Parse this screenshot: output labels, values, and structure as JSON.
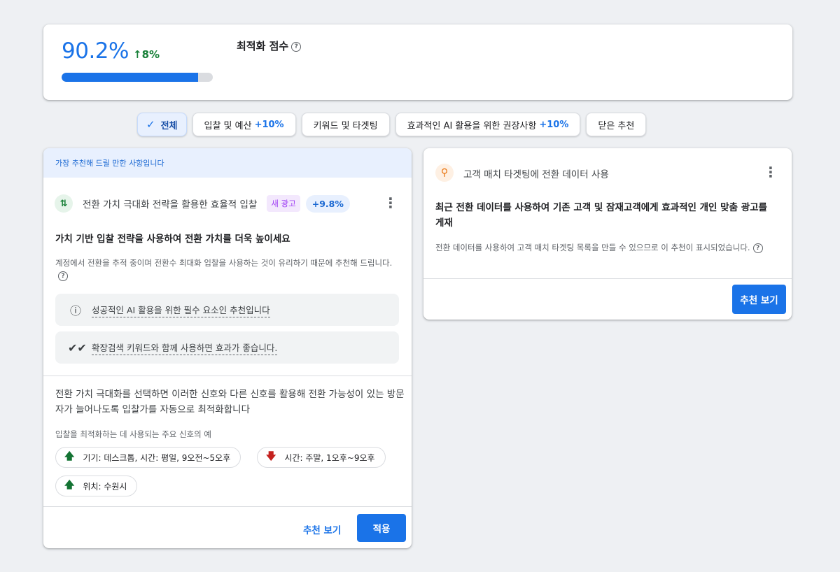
{
  "score": {
    "value": "90.2%",
    "change": "↑8%",
    "progress": 0.902,
    "title": "최적화 점수",
    "help_icon": "help-circle-icon"
  },
  "filters": [
    {
      "label": "전체",
      "pct": "",
      "active": true
    },
    {
      "label": "입찰 및 예산",
      "pct": "+10%",
      "active": false
    },
    {
      "label": "키워드 및 타겟팅",
      "pct": "",
      "active": false
    },
    {
      "label": "효과적인 AI 활용을 위한 권장사항",
      "pct": "+10%",
      "active": false
    },
    {
      "label": "닫은 추천",
      "pct": "",
      "active": false
    }
  ],
  "left_card": {
    "header": "가장 추천해 드릴 만한 사항입니다",
    "icon": "bidding-arrows-icon",
    "title": "전환 가치 극대화 전략을 활용한 효율적 입찰",
    "badge_new": "새 광고",
    "badge_pct": "+9.8%",
    "headline": "가치 기반 입찰 전략을 사용하여 전환 가치를 더욱 높이세요",
    "description": "계정에서 전환을 추적 중이며 전환수 최대화 입찰을 사용하는 것이 유리하기 때문에 추천해 드립니다.",
    "info_boxes": [
      {
        "icon": "ai-essential-icon",
        "text": "성공적인 AI 활용을 위한 필수 요소인 추천입니다"
      },
      {
        "icon": "double-check-icon",
        "text": "확장검색 키워드와 함께 사용하면 효과가 좋습니다."
      }
    ],
    "body": "전환 가치 극대화를 선택하면 이러한 신호와 다른 신호를 활용해 전환 가능성이 있는 방문자가 늘어나도록 입찰가를 자동으로 최적화합니다",
    "signals_label": "입찰을 최적화하는 데 사용되는 주요 신호의 예",
    "signals": [
      {
        "direction": "up",
        "text": "기기: 데스크톱, 시간: 평일, 9오전~5오후"
      },
      {
        "direction": "down",
        "text": "시간: 주말, 1오후~9오후"
      },
      {
        "direction": "up",
        "text": "위치: 수원시"
      }
    ],
    "view_label": "추천 보기",
    "apply_label": "적용"
  },
  "right_card": {
    "icon": "search-icon",
    "title": "고객 매치 타겟팅에 전환 데이터 사용",
    "headline": "최근 전환 데이터를 사용하여 기존 고객 및 잠재고객에게 효과적인 개인 맞춤 광고를 게재",
    "description": "전환 데이터를 사용하여 고객 매치 타겟팅 목록을 만들 수 있으므로 이 추천이 표시되었습니다.",
    "view_label": "추천 보기"
  },
  "colors": {
    "accent": "#1a73e8",
    "positive": "#188038",
    "negative": "#c5221f"
  }
}
